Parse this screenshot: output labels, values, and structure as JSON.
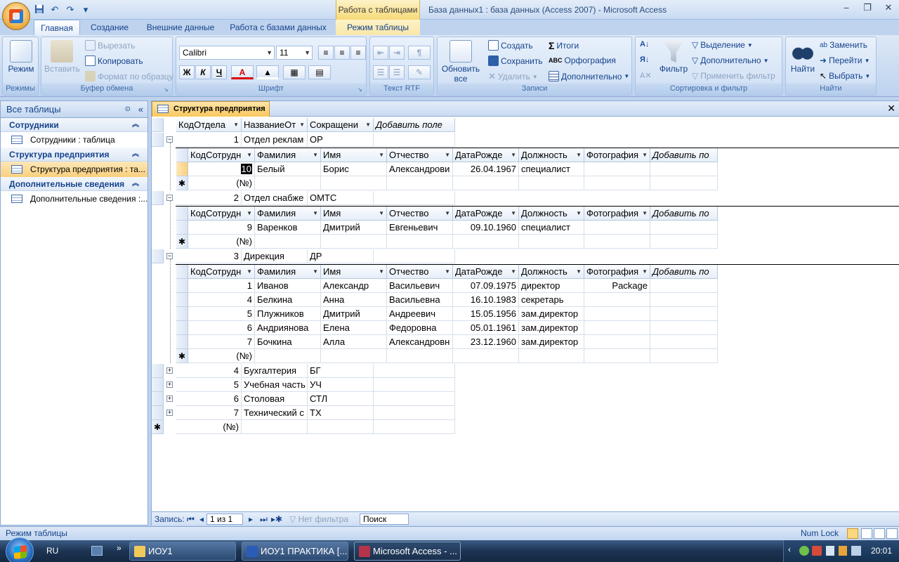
{
  "window": {
    "contextual_tab_title": "Работа с таблицами",
    "title": "База данных1 : база данных (Access 2007) - Microsoft Access",
    "minimize_glyph": "–",
    "restore_glyph": "❐",
    "close_glyph": "✕"
  },
  "qat": {
    "save_icon": "save-icon",
    "undo_glyph": "↶",
    "redo_glyph": "↷",
    "customize_glyph": "▾"
  },
  "tabs": [
    "Главная",
    "Создание",
    "Внешние данные",
    "Работа с базами данных",
    "Режим таблицы"
  ],
  "ribbon": {
    "groups": {
      "modes": "Режимы",
      "clipboard": "Буфер обмена",
      "font": "Шрифт",
      "rtf": "Текст RTF",
      "records": "Записи",
      "sort_filter": "Сортировка и фильтр",
      "find": "Найти"
    },
    "mode_btn": "Режим",
    "paste_btn": "Вставить",
    "cut": "Вырезать",
    "copy": "Копировать",
    "format_painter": "Формат по образцу",
    "font_name": "Calibri",
    "font_size": "11",
    "bold": "Ж",
    "italic": "К",
    "underline": "Ч",
    "font_color": "A",
    "refresh_line1": "Обновить",
    "refresh_line2": "все",
    "create": "Создать",
    "save": "Сохранить",
    "delete": "Удалить",
    "totals": "Итоги",
    "spelling": "Орфография",
    "more": "Дополнительно",
    "filter": "Фильтр",
    "selection": "Выделение",
    "advanced": "Дополнительно",
    "apply_filter": "Применить фильтр",
    "find": "Найти",
    "replace": "Заменить",
    "goto": "Перейти",
    "select": "Выбрать"
  },
  "nav": {
    "header": "Все таблицы",
    "groups": [
      {
        "title": "Сотрудники",
        "item": "Сотрудники : таблица"
      },
      {
        "title": "Структура предприятия",
        "item": "Структура предприятия : та..."
      },
      {
        "title": "Дополнительные сведения",
        "item": "Дополнительные сведения :..."
      }
    ]
  },
  "doc": {
    "tab_title": "Структура предприятия",
    "close_glyph": "✕",
    "main_columns": [
      "КодОтдела",
      "НазваниеОт",
      "Сокращени",
      "Добавить поле"
    ],
    "sub_columns": [
      "КодСотрудн",
      "Фамилия",
      "Имя",
      "Отчество",
      "ДатаРожде",
      "Должность",
      "Фотография",
      "Добавить по"
    ],
    "new_row_marker": "(№)",
    "new_row_symbol": "✱",
    "departments": [
      {
        "id": "1",
        "name": "Отдел реклам",
        "abbr": "ОР",
        "expanded": true,
        "employees": [
          {
            "id": "10",
            "last": "Белый",
            "first": "Борис",
            "middle": "Александрови",
            "birth": "26.04.1967",
            "position": "специалист",
            "photo": ""
          }
        ]
      },
      {
        "id": "2",
        "name": "Отдел снабже",
        "abbr": "ОМТС",
        "expanded": true,
        "employees": [
          {
            "id": "9",
            "last": "Варенков",
            "first": "Дмитрий",
            "middle": "Евгеньевич",
            "birth": "09.10.1960",
            "position": "специалист",
            "photo": ""
          }
        ]
      },
      {
        "id": "3",
        "name": "Дирекция",
        "abbr": "ДР",
        "expanded": true,
        "employees": [
          {
            "id": "1",
            "last": "Иванов",
            "first": "Александр",
            "middle": "Васильевич",
            "birth": "07.09.1975",
            "position": "директор",
            "photo": "Package"
          },
          {
            "id": "4",
            "last": "Белкина",
            "first": "Анна",
            "middle": "Васильевна",
            "birth": "16.10.1983",
            "position": "секретарь",
            "photo": ""
          },
          {
            "id": "5",
            "last": "Плужников",
            "first": "Дмитрий",
            "middle": "Андреевич",
            "birth": "15.05.1956",
            "position": "зам.директор",
            "photo": ""
          },
          {
            "id": "6",
            "last": "Андриянова",
            "first": "Елена",
            "middle": "Федоровна",
            "birth": "05.01.1961",
            "position": "зам.директор",
            "photo": ""
          },
          {
            "id": "7",
            "last": "Бочкина",
            "first": "Алла",
            "middle": "Александровн",
            "birth": "23.12.1960",
            "position": "зам.директор",
            "photo": ""
          }
        ]
      },
      {
        "id": "4",
        "name": "Бухгалтерия",
        "abbr": "БГ",
        "expanded": false,
        "employees": []
      },
      {
        "id": "5",
        "name": "Учебная часть",
        "abbr": "УЧ",
        "expanded": false,
        "employees": []
      },
      {
        "id": "6",
        "name": "Столовая",
        "abbr": "СТЛ",
        "expanded": false,
        "employees": []
      },
      {
        "id": "7",
        "name": "Технический с",
        "abbr": "ТХ",
        "expanded": false,
        "employees": []
      }
    ]
  },
  "recnav": {
    "label": "Запись:",
    "first": "⏮",
    "prev": "◂",
    "current": "1 из 1",
    "next": "▸",
    "last": "⏭",
    "new": "▸✱",
    "no_filter": "Нет фильтра",
    "search": "Поиск"
  },
  "status": {
    "left": "Режим таблицы",
    "num_lock": "Num Lock"
  },
  "taskbar": {
    "lang": "RU",
    "more_glyph": "»",
    "tasks": [
      "ИОУ1",
      "ИОУ1 ПРАКТИКА [...",
      "Microsoft Access - ..."
    ],
    "clock": "20:01"
  }
}
